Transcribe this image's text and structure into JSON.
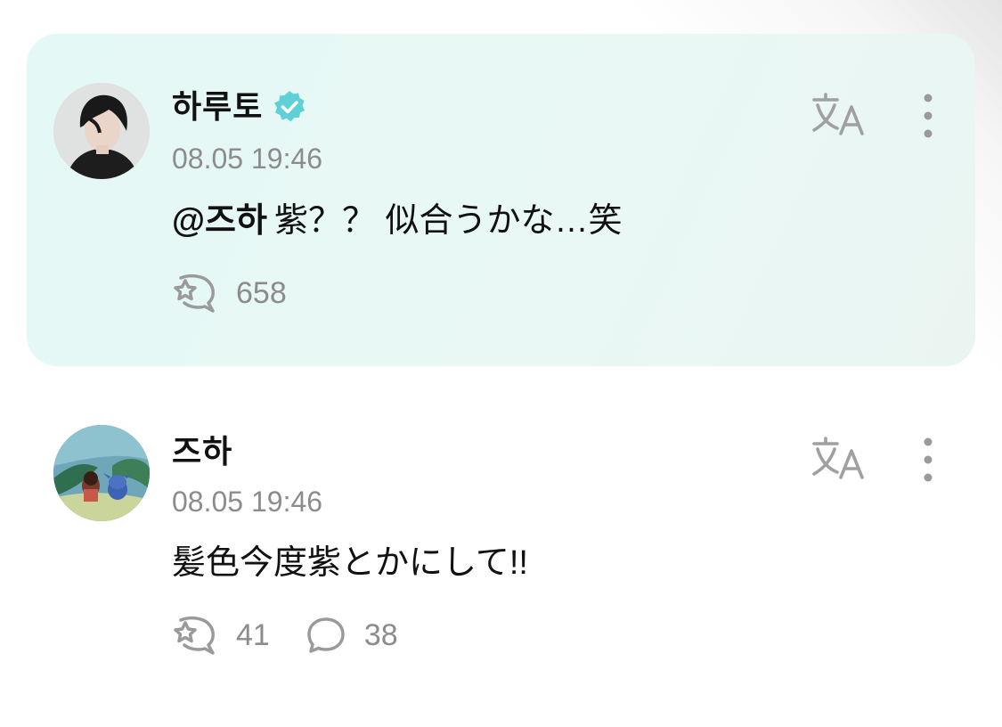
{
  "colors": {
    "highlight_background": "#e6f8f5",
    "verified_badge": "#5ed0d6",
    "secondary_text": "#8c8c8c",
    "icon_gray": "#9a9a9a"
  },
  "comments": [
    {
      "author": "하루토",
      "verified": true,
      "timestamp": "08.05 19:46",
      "mention": "@즈하",
      "text": "紫？？ 似合うかな…笑",
      "likes": "658",
      "avatar_icon": "profile-photo",
      "actions": [
        "translate-icon",
        "more-icon"
      ]
    },
    {
      "author": "즈하",
      "verified": false,
      "timestamp": "08.05 19:46",
      "text": "髪色今度紫とかにして!!",
      "likes": "41",
      "replies": "38",
      "avatar_icon": "profile-photo",
      "actions": [
        "translate-icon",
        "more-icon"
      ]
    }
  ]
}
